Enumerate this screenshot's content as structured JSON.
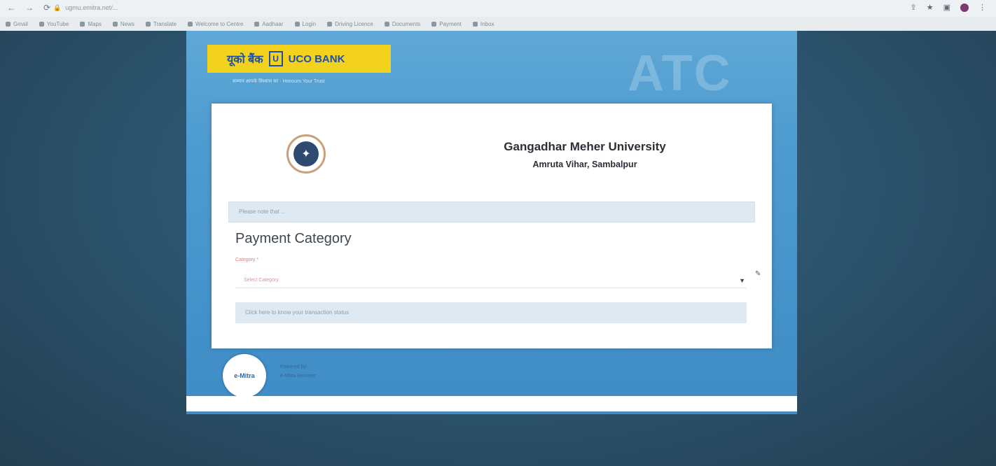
{
  "browser": {
    "url": "ugmu.emitra.net/...",
    "bookmarks": [
      "Gmail",
      "YouTube",
      "Maps",
      "News",
      "Translate",
      "Welcome to Centre",
      "Aadhaar",
      "Login",
      "Driving Licence",
      "Documents",
      "Payment",
      "Inbox"
    ]
  },
  "bank": {
    "hindi_name": "यूको बैंक",
    "name": "UCO BANK",
    "tagline": "सम्मान आपके विश्वास का · Honours Your Trust"
  },
  "watermark": "ATC",
  "university": {
    "name": "Gangadhar Meher University",
    "location": "Amruta Vihar, Sambalpur"
  },
  "notice_text": "Please note that ...",
  "payment": {
    "section_title": "Payment Category",
    "field_label": "Category *",
    "select_placeholder": "Select Category",
    "status_link": "Click here to know your transaction status"
  },
  "footer": {
    "brand": "e-Mitra",
    "line1": "Powered by",
    "line2": "e-Mitra Services"
  }
}
